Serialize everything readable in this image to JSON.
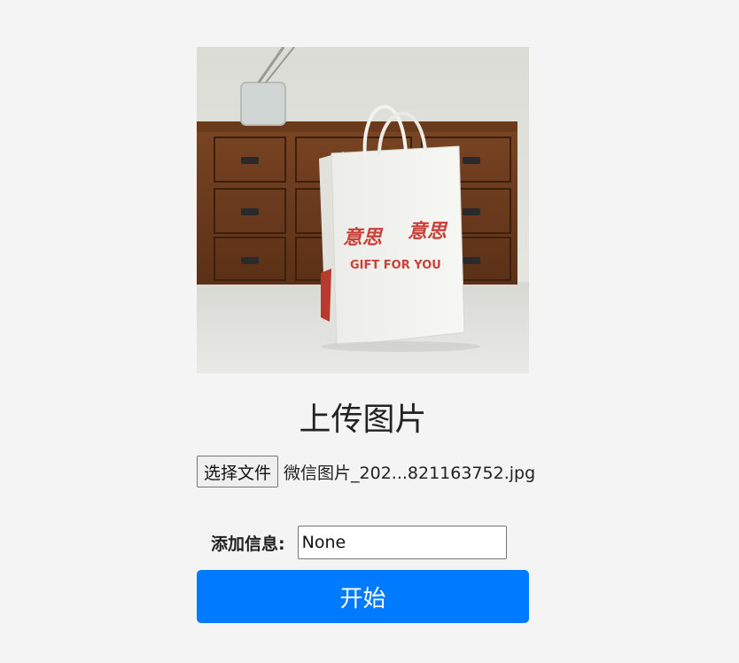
{
  "preview_image": {
    "bag_title_left": "意思",
    "bag_title_right": "意思",
    "bag_subtitle": "GIFT FOR YOU"
  },
  "page_title": "上传图片",
  "file_input": {
    "button_label": "选择文件",
    "selected_file": "微信图片_202...821163752.jpg"
  },
  "info": {
    "label": "添加信息:",
    "value": "None"
  },
  "start_button_label": "开始",
  "colors": {
    "background": "#f4f4f4",
    "primary": "#007bff",
    "bag_print": "#c8413a"
  }
}
